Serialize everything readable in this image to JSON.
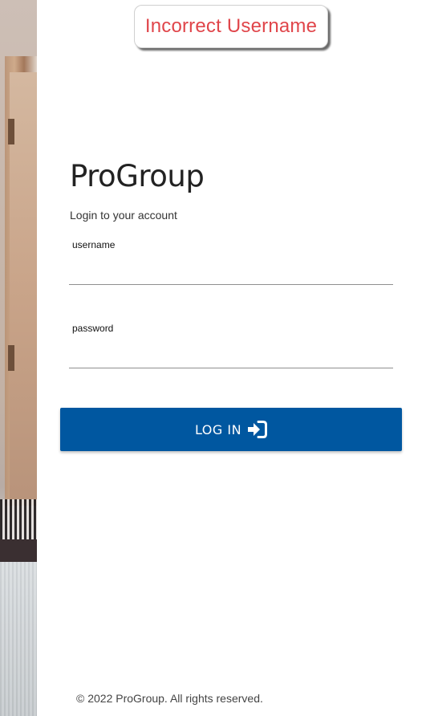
{
  "toast": {
    "message": "Incorrect Username",
    "color": "#e0454a"
  },
  "brand": {
    "name": "ProGroup"
  },
  "login": {
    "subtitle": "Login to your account",
    "username": {
      "label": "username",
      "value": "",
      "placeholder": ""
    },
    "password": {
      "label": "password",
      "value": "",
      "placeholder": ""
    },
    "button_label": "LOG IN",
    "button_icon": "sign-in-icon",
    "button_color": "#0057a0"
  },
  "footer": {
    "copyright": "© 2022 ProGroup. All rights reserved."
  }
}
